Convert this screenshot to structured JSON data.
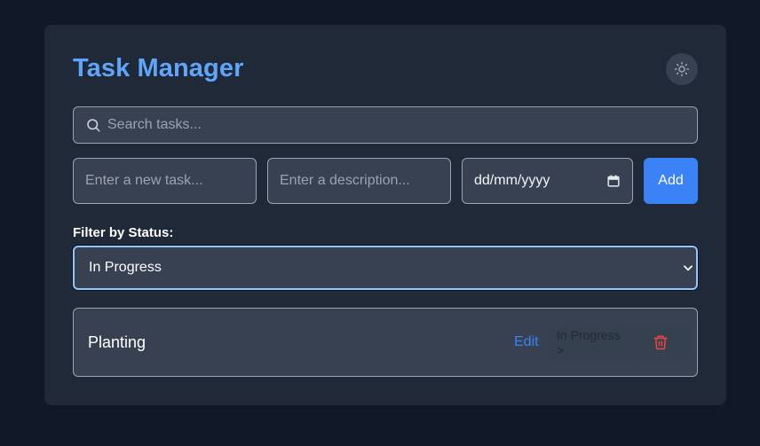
{
  "app": {
    "title": "Task Manager"
  },
  "theme_toggle": {
    "icon": "sun-icon"
  },
  "search": {
    "placeholder": "Search tasks...",
    "icon": "search-icon"
  },
  "new_task": {
    "title_placeholder": "Enter a new task...",
    "description_placeholder": "Enter a description...",
    "date_value": "dd/mm/yyyy",
    "date_icon": "calendar-icon",
    "add_label": "Add"
  },
  "filter": {
    "label": "Filter by Status:",
    "selected": "In Progress"
  },
  "tasks": [
    {
      "name": "Planting",
      "edit_label": "Edit",
      "status_label": "In Progress",
      "status_arrow": ">",
      "delete_icon": "trash-icon"
    }
  ],
  "colors": {
    "background": "#111827",
    "card": "#1f2937",
    "accent": "#60a5fa",
    "primary_button": "#3b82f6",
    "delete": "#ef4444"
  }
}
